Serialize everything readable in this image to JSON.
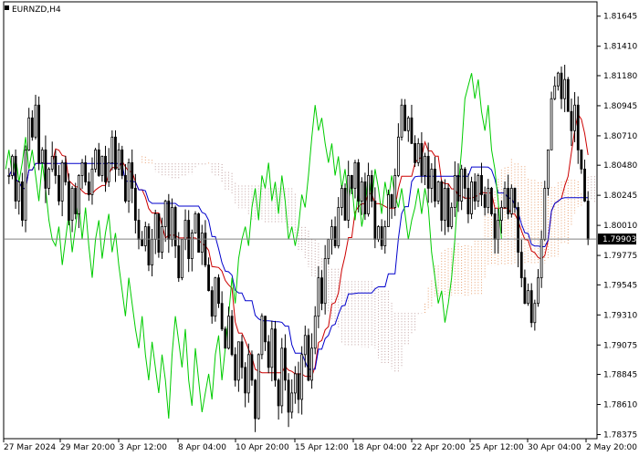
{
  "window": {
    "symbol_timeframe": "EURNZD,H4"
  },
  "colors": {
    "background": "#ffffff",
    "candles": "#000000",
    "tenkan": "#cc0000",
    "kijun": "#0000cc",
    "chikou": "#00cc00",
    "cloud_a": "#e8a070",
    "cloud_b": "#c0a0a0",
    "current_price_line": "#808080",
    "current_price_box": "#000000"
  },
  "icons": {
    "indicator": "square-icon"
  },
  "chart_data": {
    "type": "candlestick",
    "instrument": "EURNZD",
    "timeframe": "H4",
    "indicator": "Ichimoku Kinko Hyo",
    "current_price": "1.79903",
    "ylim": [
      1.7835,
      1.8175
    ],
    "y_ticks": [
      "1.81645",
      "1.81410",
      "1.81180",
      "1.80945",
      "1.80710",
      "1.80480",
      "1.80245",
      "1.80010",
      "1.79775",
      "1.79545",
      "1.79310",
      "1.79075",
      "1.78845",
      "1.78610",
      "1.78375"
    ],
    "x_ticks": [
      "27 Mar 2024",
      "29 Mar 20:00",
      "3 Apr 12:00",
      "8 Apr 04:00",
      "10 Apr 20:00",
      "15 Apr 12:00",
      "18 Apr 04:00",
      "22 Apr 20:00",
      "25 Apr 12:00",
      "30 Apr 04:00",
      "2 May 20:00"
    ],
    "close": [
      1.804,
      1.8055,
      1.802,
      1.8035,
      1.8005,
      1.806,
      1.8085,
      1.807,
      1.8095,
      1.805,
      1.806,
      1.803,
      1.8045,
      1.8055,
      1.804,
      1.802,
      1.805,
      1.8035,
      1.8005,
      1.803,
      1.801,
      1.804,
      1.805,
      1.8035,
      1.8025,
      1.8045,
      1.806,
      1.804,
      1.8055,
      1.8035,
      1.805,
      1.807,
      1.8045,
      1.806,
      1.804,
      1.802,
      1.805,
      1.803,
      1.8005,
      1.799,
      1.7985,
      1.8,
      1.797,
      1.799,
      1.801,
      1.798,
      1.8,
      1.802,
      1.799,
      1.8015,
      1.7985,
      1.796,
      1.799,
      1.8005,
      1.7975,
      1.7995,
      1.801,
      1.798,
      1.7995,
      1.797,
      1.795,
      1.793,
      1.796,
      1.794,
      1.792,
      1.7905,
      1.793,
      1.79,
      1.788,
      1.791,
      1.789,
      1.787,
      1.79,
      1.788,
      1.785,
      1.79,
      1.793,
      1.791,
      1.789,
      1.792,
      1.788,
      1.786,
      1.7905,
      1.788,
      1.7855,
      1.787,
      1.7885,
      1.7865,
      1.79,
      1.7915,
      1.788,
      1.7905,
      1.793,
      1.796,
      1.794,
      1.7975,
      1.799,
      1.8,
      1.7985,
      1.8015,
      1.803,
      1.8005,
      1.804,
      1.803,
      1.805,
      1.802,
      1.8035,
      1.801,
      1.804,
      1.802,
      1.799,
      1.8,
      1.7985,
      1.8,
      1.8025,
      1.8015,
      1.804,
      1.807,
      1.8095,
      1.8075,
      1.8085,
      1.8065,
      1.805,
      1.8065,
      1.804,
      1.8055,
      1.803,
      1.8045,
      1.802,
      1.8035,
      1.8005,
      1.803,
      1.8,
      1.8015,
      1.804,
      1.802,
      1.8045,
      1.803,
      1.801,
      1.8035,
      1.802,
      1.804,
      1.8025,
      1.8015,
      1.803,
      1.801,
      1.799,
      1.8005,
      1.8015,
      1.803,
      1.801,
      1.803,
      1.8015,
      1.798,
      1.796,
      1.794,
      1.795,
      1.7925,
      1.794,
      1.796,
      1.799,
      1.803,
      1.806,
      1.81,
      1.811,
      1.812,
      1.81,
      1.8115,
      1.809,
      1.8075,
      1.8095,
      1.806,
      1.8045,
      1.802,
      1.799
    ]
  }
}
